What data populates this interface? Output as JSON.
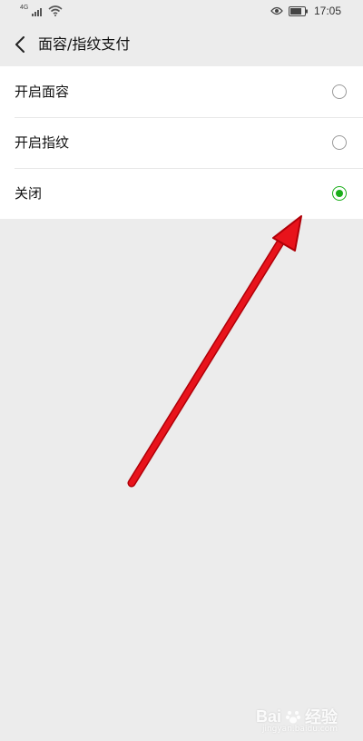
{
  "status_bar": {
    "network_label": "4G",
    "time": "17:05",
    "icons": [
      "signal-icon",
      "wifi-icon",
      "eye-icon",
      "battery-icon"
    ]
  },
  "nav": {
    "back_icon": "chevron-left-icon",
    "title": "面容/指纹支付"
  },
  "options": [
    {
      "label": "开启面容",
      "selected": false
    },
    {
      "label": "开启指纹",
      "selected": false
    },
    {
      "label": "关闭",
      "selected": true
    }
  ],
  "colors": {
    "accent_green": "#1aad19",
    "background": "#ececec",
    "annotation_red": "#e8131b"
  },
  "watermark": {
    "brand": "Bai",
    "brand_suffix": "经验",
    "sub": "jingyan.baidu.com"
  }
}
